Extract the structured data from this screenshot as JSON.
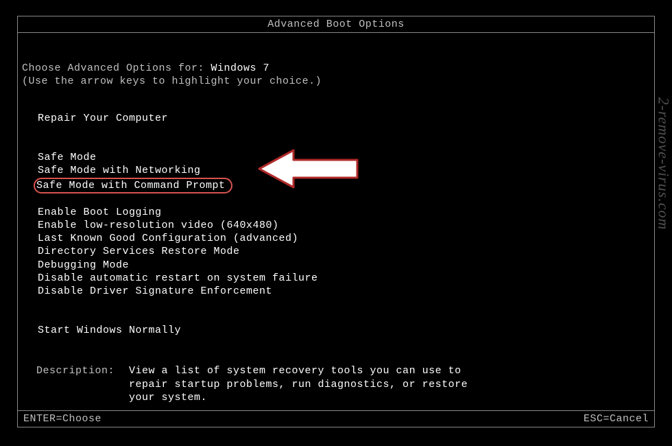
{
  "title": "Advanced Boot Options",
  "intro": {
    "prefix": "Choose Advanced Options for: ",
    "os": "Windows 7"
  },
  "hint": "(Use the arrow keys to highlight your choice.)",
  "menu": {
    "group1": [
      "Repair Your Computer"
    ],
    "group2": [
      "Safe Mode",
      "Safe Mode with Networking",
      "Safe Mode with Command Prompt"
    ],
    "group3": [
      "Enable Boot Logging",
      "Enable low-resolution video (640x480)",
      "Last Known Good Configuration (advanced)",
      "Directory Services Restore Mode",
      "Debugging Mode",
      "Disable automatic restart on system failure",
      "Disable Driver Signature Enforcement"
    ],
    "group4": [
      "Start Windows Normally"
    ]
  },
  "description": {
    "label": "Description:",
    "text": "View a list of system recovery tools you can use to repair startup problems, run diagnostics, or restore your system."
  },
  "footer": {
    "left": "ENTER=Choose",
    "right": "ESC=Cancel"
  },
  "watermark": "2-remove-virus.com"
}
